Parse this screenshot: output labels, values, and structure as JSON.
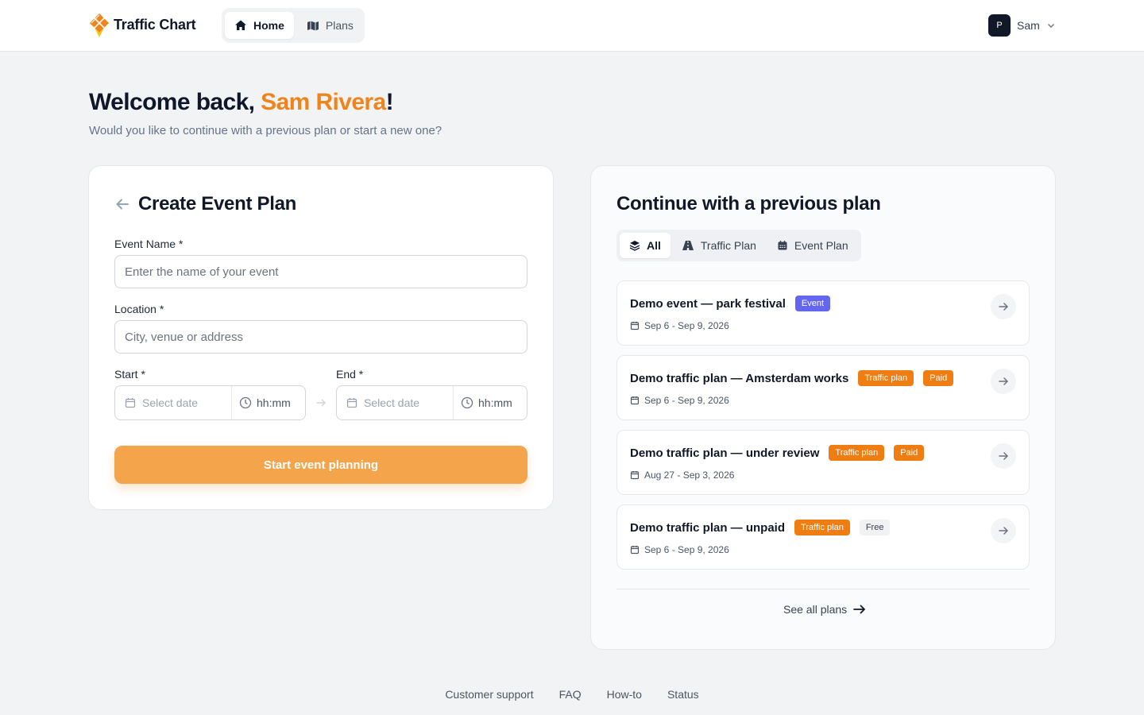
{
  "app": {
    "name": "Traffic Chart",
    "brand_color": "#f0841a"
  },
  "nav": {
    "tabs": [
      {
        "label": "Home",
        "icon": "home-icon",
        "active": true
      },
      {
        "label": "Plans",
        "icon": "map-icon",
        "active": false
      }
    ]
  },
  "user": {
    "initial": "P",
    "name": "Sam"
  },
  "greeting": {
    "prefix": "Welcome back, ",
    "name": "Sam Rivera",
    "suffix": "!",
    "subtitle": "Would you like to continue with a previous plan or start a new one?"
  },
  "create_form": {
    "title": "Create Event Plan",
    "event_name": {
      "label": "Event Name *",
      "placeholder": "Enter the name of your event",
      "value": ""
    },
    "location": {
      "label": "Location *",
      "placeholder": "City, venue or address",
      "value": ""
    },
    "start": {
      "label": "Start *",
      "date_placeholder": "Select date",
      "time_placeholder": "hh:mm"
    },
    "end": {
      "label": "End *",
      "date_placeholder": "Select date",
      "time_placeholder": "hh:mm"
    },
    "submit_label": "Start event planning"
  },
  "previous": {
    "title": "Continue with a previous plan",
    "filters": [
      {
        "label": "All",
        "icon": "layers-icon",
        "active": true
      },
      {
        "label": "Traffic Plan",
        "icon": "road-icon",
        "active": false
      },
      {
        "label": "Event Plan",
        "icon": "calendar-icon",
        "active": false
      }
    ],
    "plans": [
      {
        "name": "Demo event — park festival",
        "badges": [
          {
            "text": "Event",
            "kind": "event"
          }
        ],
        "dates": "Sep 6 - Sep 9, 2026"
      },
      {
        "name": "Demo traffic plan — Amsterdam works",
        "badges": [
          {
            "text": "Traffic plan",
            "kind": "traffic"
          },
          {
            "text": "Paid",
            "kind": "paid"
          }
        ],
        "dates": "Sep 6 - Sep 9, 2026"
      },
      {
        "name": "Demo traffic plan — under review",
        "badges": [
          {
            "text": "Traffic plan",
            "kind": "traffic"
          },
          {
            "text": "Paid",
            "kind": "paid"
          }
        ],
        "dates": "Aug 27 - Sep 3, 2026"
      },
      {
        "name": "Demo traffic plan — unpaid",
        "badges": [
          {
            "text": "Traffic plan",
            "kind": "traffic"
          },
          {
            "text": "Free",
            "kind": "free"
          }
        ],
        "dates": "Sep 6 - Sep 9, 2026"
      }
    ],
    "see_all_label": "See all plans"
  },
  "footer": {
    "links": [
      "Customer support",
      "FAQ",
      "How-to",
      "Status"
    ]
  }
}
